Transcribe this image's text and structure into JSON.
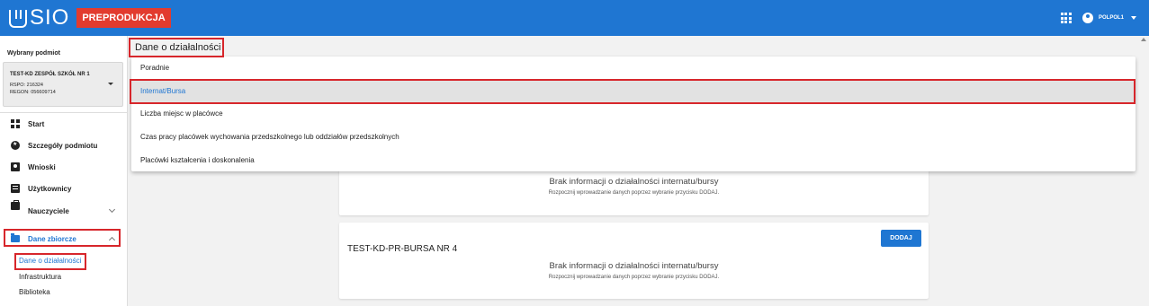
{
  "header": {
    "logo": "SIO",
    "env_badge": "PREPRODUKCJA",
    "user": "POLPOL1"
  },
  "sidebar": {
    "section_title": "Wybrany podmiot",
    "entity": {
      "name": "TEST-KD ZESPÓŁ SZKÓŁ NR 1",
      "rspo": "RSPO: 216324",
      "regon": "REGON: 056609714"
    },
    "nav": [
      {
        "label": "Start",
        "icon": "dashboard-icon"
      },
      {
        "label": "Szczegóły podmiotu",
        "icon": "star-circle-icon"
      },
      {
        "label": "Wnioski",
        "icon": "account-box-icon"
      },
      {
        "label": "Użytkownicy",
        "icon": "badge-icon"
      },
      {
        "label": "Nauczyciele",
        "icon": "briefcase-icon",
        "expanded": false
      },
      {
        "label": "Dane zbiorcze",
        "icon": "folder-icon",
        "expanded": true
      }
    ],
    "subnav": [
      "Dane o działalności",
      "Infrastruktura",
      "Biblioteka"
    ]
  },
  "main": {
    "title": "Dane o działalności",
    "dropdown": {
      "selected": "Internat/Bursa",
      "options": [
        "Poradnie",
        "Internat/Bursa",
        "Liczba miejsc w placówce",
        "Czas pracy placówek wychowania przedszkolnego lub oddziałów przedszkolnych",
        "Placówki kształcenia i doskonalenia"
      ]
    },
    "cards": [
      {
        "title": "",
        "empty_title": "Brak informacji o działalności internatu/bursy",
        "empty_sub": "Rozpocznij wprowadzanie danych poprzez wybranie przycisku DODAJ."
      },
      {
        "title": "TEST-KD-PR-BURSA NR 4",
        "button": "DODAJ",
        "empty_title": "Brak informacji o działalności internatu/bursy",
        "empty_sub": "Rozpocznij wprowadzanie danych poprzez wybranie przycisku DODAJ."
      }
    ]
  },
  "colors": {
    "primary": "#1f76d2",
    "badge": "#e23b2e",
    "highlight_border": "#d7262b"
  }
}
